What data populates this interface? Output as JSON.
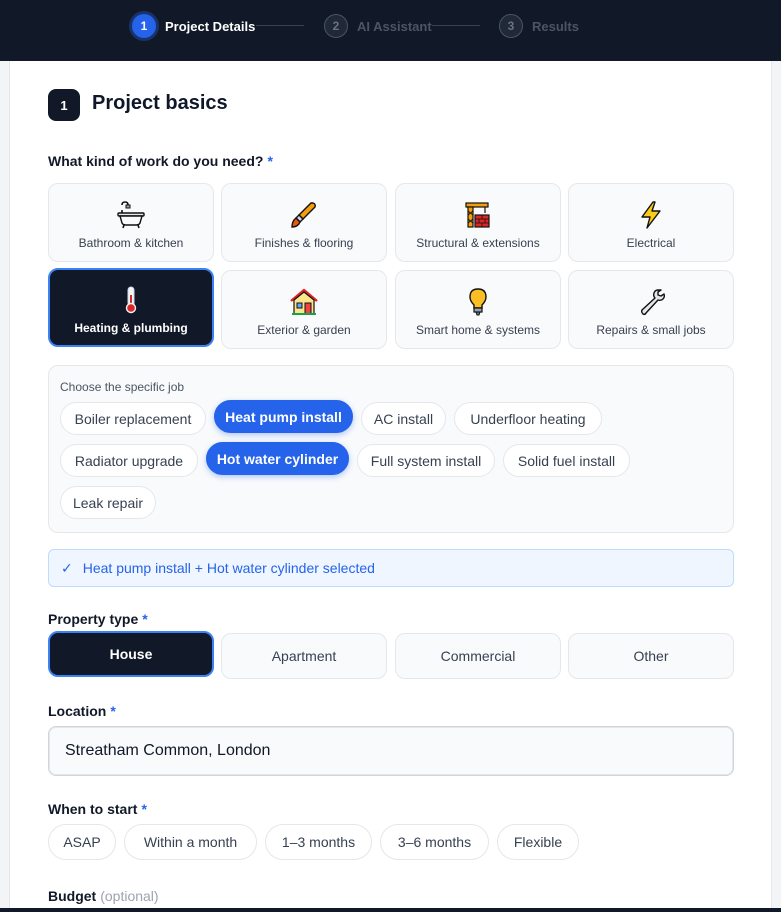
{
  "stepper": [
    {
      "num": "1",
      "label": "Project Details"
    },
    {
      "num": "2",
      "label": "AI Assistant"
    },
    {
      "num": "3",
      "label": "Results"
    }
  ],
  "section": {
    "badge": "1",
    "title": "Project basics"
  },
  "work": {
    "label": "What kind of work do you need?",
    "required": "*",
    "categories": [
      {
        "label": "Bathroom & kitchen",
        "icon": "bathtub-icon"
      },
      {
        "label": "Finishes & flooring",
        "icon": "paintbrush-icon"
      },
      {
        "label": "Structural & extensions",
        "icon": "construction-crane-icon"
      },
      {
        "label": "Electrical",
        "icon": "lightning-icon"
      },
      {
        "label": "Heating & plumbing",
        "icon": "thermometer-icon",
        "selected": true
      },
      {
        "label": "Exterior & garden",
        "icon": "house-icon"
      },
      {
        "label": "Smart home & systems",
        "icon": "lightbulb-icon"
      },
      {
        "label": "Repairs & small jobs",
        "icon": "wrench-icon"
      }
    ]
  },
  "jobs": {
    "title": "Choose the specific job",
    "options": [
      {
        "label": "Boiler replacement"
      },
      {
        "label": "Heat pump install",
        "selected": true
      },
      {
        "label": "AC install"
      },
      {
        "label": "Underfloor heating"
      },
      {
        "label": "Radiator upgrade"
      },
      {
        "label": "Hot water cylinder",
        "selected": true
      },
      {
        "label": "Full system install"
      },
      {
        "label": "Solid fuel install"
      },
      {
        "label": "Leak repair"
      }
    ]
  },
  "selection_summary": {
    "check": "✓",
    "text": "Heat pump install + Hot water cylinder selected"
  },
  "property_type": {
    "label": "Property type",
    "required": "*",
    "options": [
      "House",
      "Apartment",
      "Commercial",
      "Other"
    ],
    "selected": "House"
  },
  "location": {
    "label": "Location",
    "required": "*",
    "value": "Streatham Common, London"
  },
  "when_to_start": {
    "label": "When to start",
    "required": "*",
    "options": [
      "ASAP",
      "Within a month",
      "1–3 months",
      "3–6 months",
      "Flexible"
    ]
  },
  "budget": {
    "label": "Budget",
    "optional": "(optional)"
  },
  "colors": {
    "accent": "#2563eb",
    "dark": "#111827",
    "panel": "#f8fafc"
  }
}
